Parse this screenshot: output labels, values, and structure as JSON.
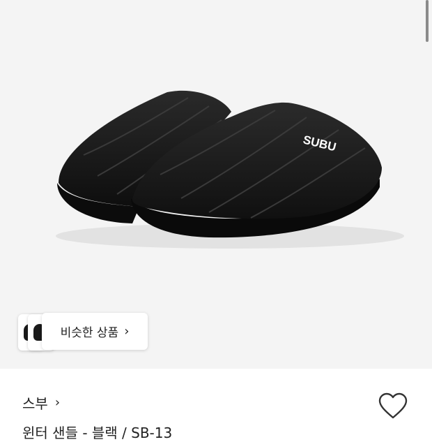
{
  "product": {
    "image_alt": "SUBU",
    "logo_text": "SUBU",
    "brand": "스부",
    "title": "윈터 샌들 - 블랙 / SB-13"
  },
  "similar": {
    "label": "비슷한 상품"
  },
  "icons": {
    "brand_chevron": "chevron-right-icon",
    "similar_chevron": "chevron-right-icon",
    "wishlist": "heart-outline-icon"
  },
  "colors": {
    "image_background": "#f4f4f4",
    "slipper": "#141414",
    "text": "#222222"
  }
}
